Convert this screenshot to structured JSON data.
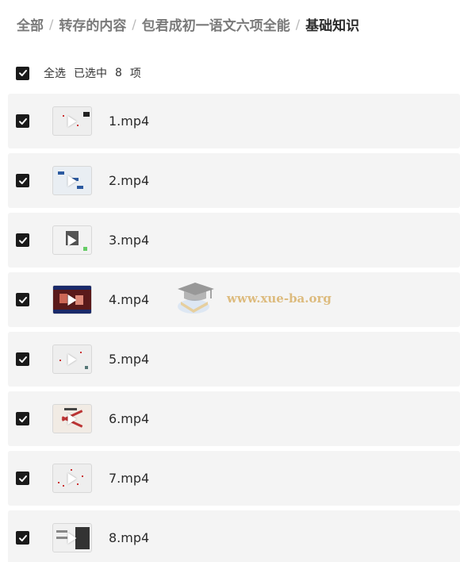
{
  "breadcrumb": {
    "items": [
      "全部",
      "转存的内容",
      "包君成初一语文六项全能"
    ],
    "current": "基础知识",
    "separator": "/"
  },
  "selection": {
    "select_all_label": "全选",
    "selected_prefix": "已选中",
    "selected_count": "8",
    "selected_suffix": "项"
  },
  "files": [
    {
      "name": "1.mp4",
      "checked": true
    },
    {
      "name": "2.mp4",
      "checked": true
    },
    {
      "name": "3.mp4",
      "checked": true
    },
    {
      "name": "4.mp4",
      "checked": true
    },
    {
      "name": "5.mp4",
      "checked": true
    },
    {
      "name": "6.mp4",
      "checked": true
    },
    {
      "name": "7.mp4",
      "checked": true
    },
    {
      "name": "8.mp4",
      "checked": true
    }
  ],
  "watermark": {
    "text": "www.xue-ba.org"
  },
  "colors": {
    "checkbox": "#1a1a1a",
    "row_background": "#f4f4f4",
    "watermark": "#d9b26a"
  }
}
